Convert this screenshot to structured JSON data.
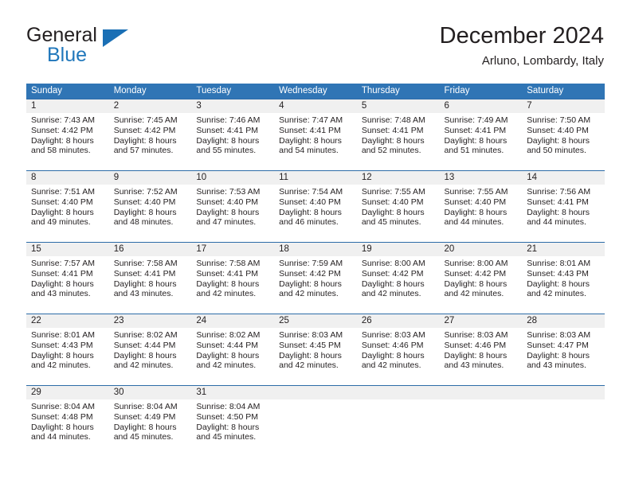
{
  "brand": {
    "word_one": "General",
    "word_two": "Blue",
    "triangle_icon": "triangle-icon",
    "accent_color": "#1a6fb5"
  },
  "header": {
    "title": "December 2024",
    "subtitle": "Arluno, Lombardy, Italy"
  },
  "calendar": {
    "header_bg": "#3075b5",
    "daynum_bg": "#f0f0f0",
    "day_names": [
      "Sunday",
      "Monday",
      "Tuesday",
      "Wednesday",
      "Thursday",
      "Friday",
      "Saturday"
    ],
    "weeks": [
      [
        {
          "day": "1",
          "sunrise": "Sunrise: 7:43 AM",
          "sunset": "Sunset: 4:42 PM",
          "daylight_1": "Daylight: 8 hours",
          "daylight_2": "and 58 minutes."
        },
        {
          "day": "2",
          "sunrise": "Sunrise: 7:45 AM",
          "sunset": "Sunset: 4:42 PM",
          "daylight_1": "Daylight: 8 hours",
          "daylight_2": "and 57 minutes."
        },
        {
          "day": "3",
          "sunrise": "Sunrise: 7:46 AM",
          "sunset": "Sunset: 4:41 PM",
          "daylight_1": "Daylight: 8 hours",
          "daylight_2": "and 55 minutes."
        },
        {
          "day": "4",
          "sunrise": "Sunrise: 7:47 AM",
          "sunset": "Sunset: 4:41 PM",
          "daylight_1": "Daylight: 8 hours",
          "daylight_2": "and 54 minutes."
        },
        {
          "day": "5",
          "sunrise": "Sunrise: 7:48 AM",
          "sunset": "Sunset: 4:41 PM",
          "daylight_1": "Daylight: 8 hours",
          "daylight_2": "and 52 minutes."
        },
        {
          "day": "6",
          "sunrise": "Sunrise: 7:49 AM",
          "sunset": "Sunset: 4:41 PM",
          "daylight_1": "Daylight: 8 hours",
          "daylight_2": "and 51 minutes."
        },
        {
          "day": "7",
          "sunrise": "Sunrise: 7:50 AM",
          "sunset": "Sunset: 4:40 PM",
          "daylight_1": "Daylight: 8 hours",
          "daylight_2": "and 50 minutes."
        }
      ],
      [
        {
          "day": "8",
          "sunrise": "Sunrise: 7:51 AM",
          "sunset": "Sunset: 4:40 PM",
          "daylight_1": "Daylight: 8 hours",
          "daylight_2": "and 49 minutes."
        },
        {
          "day": "9",
          "sunrise": "Sunrise: 7:52 AM",
          "sunset": "Sunset: 4:40 PM",
          "daylight_1": "Daylight: 8 hours",
          "daylight_2": "and 48 minutes."
        },
        {
          "day": "10",
          "sunrise": "Sunrise: 7:53 AM",
          "sunset": "Sunset: 4:40 PM",
          "daylight_1": "Daylight: 8 hours",
          "daylight_2": "and 47 minutes."
        },
        {
          "day": "11",
          "sunrise": "Sunrise: 7:54 AM",
          "sunset": "Sunset: 4:40 PM",
          "daylight_1": "Daylight: 8 hours",
          "daylight_2": "and 46 minutes."
        },
        {
          "day": "12",
          "sunrise": "Sunrise: 7:55 AM",
          "sunset": "Sunset: 4:40 PM",
          "daylight_1": "Daylight: 8 hours",
          "daylight_2": "and 45 minutes."
        },
        {
          "day": "13",
          "sunrise": "Sunrise: 7:55 AM",
          "sunset": "Sunset: 4:40 PM",
          "daylight_1": "Daylight: 8 hours",
          "daylight_2": "and 44 minutes."
        },
        {
          "day": "14",
          "sunrise": "Sunrise: 7:56 AM",
          "sunset": "Sunset: 4:41 PM",
          "daylight_1": "Daylight: 8 hours",
          "daylight_2": "and 44 minutes."
        }
      ],
      [
        {
          "day": "15",
          "sunrise": "Sunrise: 7:57 AM",
          "sunset": "Sunset: 4:41 PM",
          "daylight_1": "Daylight: 8 hours",
          "daylight_2": "and 43 minutes."
        },
        {
          "day": "16",
          "sunrise": "Sunrise: 7:58 AM",
          "sunset": "Sunset: 4:41 PM",
          "daylight_1": "Daylight: 8 hours",
          "daylight_2": "and 43 minutes."
        },
        {
          "day": "17",
          "sunrise": "Sunrise: 7:58 AM",
          "sunset": "Sunset: 4:41 PM",
          "daylight_1": "Daylight: 8 hours",
          "daylight_2": "and 42 minutes."
        },
        {
          "day": "18",
          "sunrise": "Sunrise: 7:59 AM",
          "sunset": "Sunset: 4:42 PM",
          "daylight_1": "Daylight: 8 hours",
          "daylight_2": "and 42 minutes."
        },
        {
          "day": "19",
          "sunrise": "Sunrise: 8:00 AM",
          "sunset": "Sunset: 4:42 PM",
          "daylight_1": "Daylight: 8 hours",
          "daylight_2": "and 42 minutes."
        },
        {
          "day": "20",
          "sunrise": "Sunrise: 8:00 AM",
          "sunset": "Sunset: 4:42 PM",
          "daylight_1": "Daylight: 8 hours",
          "daylight_2": "and 42 minutes."
        },
        {
          "day": "21",
          "sunrise": "Sunrise: 8:01 AM",
          "sunset": "Sunset: 4:43 PM",
          "daylight_1": "Daylight: 8 hours",
          "daylight_2": "and 42 minutes."
        }
      ],
      [
        {
          "day": "22",
          "sunrise": "Sunrise: 8:01 AM",
          "sunset": "Sunset: 4:43 PM",
          "daylight_1": "Daylight: 8 hours",
          "daylight_2": "and 42 minutes."
        },
        {
          "day": "23",
          "sunrise": "Sunrise: 8:02 AM",
          "sunset": "Sunset: 4:44 PM",
          "daylight_1": "Daylight: 8 hours",
          "daylight_2": "and 42 minutes."
        },
        {
          "day": "24",
          "sunrise": "Sunrise: 8:02 AM",
          "sunset": "Sunset: 4:44 PM",
          "daylight_1": "Daylight: 8 hours",
          "daylight_2": "and 42 minutes."
        },
        {
          "day": "25",
          "sunrise": "Sunrise: 8:03 AM",
          "sunset": "Sunset: 4:45 PM",
          "daylight_1": "Daylight: 8 hours",
          "daylight_2": "and 42 minutes."
        },
        {
          "day": "26",
          "sunrise": "Sunrise: 8:03 AM",
          "sunset": "Sunset: 4:46 PM",
          "daylight_1": "Daylight: 8 hours",
          "daylight_2": "and 42 minutes."
        },
        {
          "day": "27",
          "sunrise": "Sunrise: 8:03 AM",
          "sunset": "Sunset: 4:46 PM",
          "daylight_1": "Daylight: 8 hours",
          "daylight_2": "and 43 minutes."
        },
        {
          "day": "28",
          "sunrise": "Sunrise: 8:03 AM",
          "sunset": "Sunset: 4:47 PM",
          "daylight_1": "Daylight: 8 hours",
          "daylight_2": "and 43 minutes."
        }
      ],
      [
        {
          "day": "29",
          "sunrise": "Sunrise: 8:04 AM",
          "sunset": "Sunset: 4:48 PM",
          "daylight_1": "Daylight: 8 hours",
          "daylight_2": "and 44 minutes."
        },
        {
          "day": "30",
          "sunrise": "Sunrise: 8:04 AM",
          "sunset": "Sunset: 4:49 PM",
          "daylight_1": "Daylight: 8 hours",
          "daylight_2": "and 45 minutes."
        },
        {
          "day": "31",
          "sunrise": "Sunrise: 8:04 AM",
          "sunset": "Sunset: 4:50 PM",
          "daylight_1": "Daylight: 8 hours",
          "daylight_2": "and 45 minutes."
        },
        {
          "day": "",
          "sunrise": "",
          "sunset": "",
          "daylight_1": "",
          "daylight_2": ""
        },
        {
          "day": "",
          "sunrise": "",
          "sunset": "",
          "daylight_1": "",
          "daylight_2": ""
        },
        {
          "day": "",
          "sunrise": "",
          "sunset": "",
          "daylight_1": "",
          "daylight_2": ""
        },
        {
          "day": "",
          "sunrise": "",
          "sunset": "",
          "daylight_1": "",
          "daylight_2": ""
        }
      ]
    ]
  }
}
